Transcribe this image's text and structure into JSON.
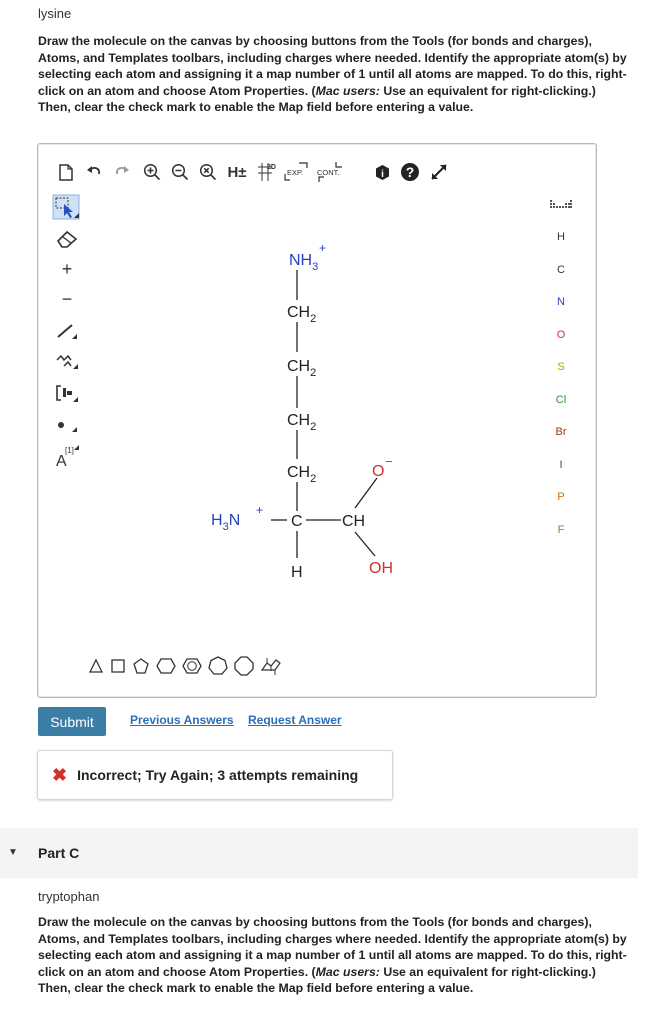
{
  "partB": {
    "name": "lysine",
    "instructions_part1": "Draw the molecule on the canvas by choosing buttons from the Tools (for bonds and charges), Atoms, and Templates toolbars, including charges where needed. Identify the appropriate atom(s) by selecting each atom and assigning it a map number of 1 until all atoms are mapped. To do this, right-click on an atom and choose Atom Properties. (",
    "instructions_mac": "Mac users:",
    "instructions_part2": " Use an equivalent for right-clicking.) Then, clear the check mark to enable the Map field before entering a value."
  },
  "toolbar_top": {
    "new_icon": "document-icon",
    "undo": "undo-icon",
    "redo": "redo-icon",
    "zoom_in": "zoom-in-icon",
    "zoom_out": "zoom-out-icon",
    "zoom_reset": "zoom-reset-icon",
    "h_label": "H±",
    "label_2d": "2D",
    "label_exp": "EXP.",
    "label_cont": "CONT.",
    "info": "info-icon",
    "help": "?",
    "expand": "expand-icon"
  },
  "toolbar_left": {
    "charge_label": "[1]",
    "atom_label": "A"
  },
  "atoms_toolbar": [
    "H",
    "C",
    "N",
    "O",
    "S",
    "Cl",
    "Br",
    "I",
    "P",
    "F"
  ],
  "atom_colors": {
    "H": "#333333",
    "C": "#333333",
    "N": "#2a3fbf",
    "O": "#d0312d",
    "S": "#b59a00",
    "Cl": "#2f8a2f",
    "Br": "#8b3a1a",
    "I": "#6a2a8a",
    "P": "#d0700a",
    "F": "#5a9a2a"
  },
  "molecule": {
    "nh3": "NH",
    "nh3_sub": "3",
    "nh3_charge": "+",
    "ch2": "CH",
    "ch2_sub": "2",
    "o_minus": "O",
    "o_charge": "−",
    "h3n": "H",
    "h3n_sub": "3",
    "h3n_n": "N",
    "h3n_charge": "+",
    "c": "C",
    "ch": "CH",
    "oh": "OH",
    "h": "H"
  },
  "actions": {
    "submit": "Submit",
    "previous": "Previous Answers",
    "request": "Request Answer"
  },
  "feedback": {
    "icon": "✖",
    "message": "Incorrect; Try Again; 3 attempts remaining"
  },
  "partC": {
    "header": "Part C",
    "name": "tryptophan",
    "instructions_part1": "Draw the molecule on the canvas by choosing buttons from the Tools (for bonds and charges), Atoms, and Templates toolbars, including charges where needed. Identify the appropriate atom(s) by selecting each atom and assigning it a map number of 1 until all atoms are mapped. To do this, right-click on an atom and choose Atom Properties. (",
    "instructions_mac": "Mac users:",
    "instructions_part2": " Use an equivalent for right-clicking.) Then, clear the check mark to enable the Map field before entering a value."
  }
}
